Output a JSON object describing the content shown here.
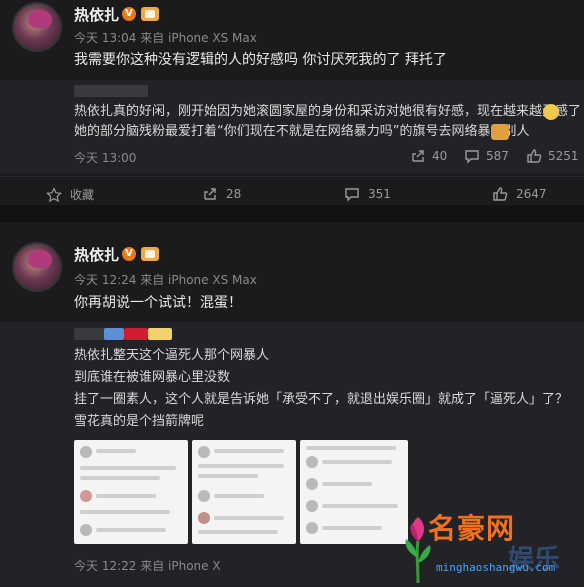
{
  "post1": {
    "username": "热依扎",
    "v_badge": "V",
    "meta": "今天 13:04 来自 iPhone XS Max",
    "text": "我需要你这种没有逻辑的人的好感吗 你讨厌死我的了 拜托了",
    "repost": {
      "line1": "热依扎真的好闲，刚开始因为她滚圆家屋的身份和采访对她很有好感，现在越来越无感了",
      "line2": "她的部分脑残粉最爱打着“你们现在不就是在网络暴力吗”的旗号去网络暴力别人",
      "meta": "今天 13:00",
      "stats": {
        "share": "40",
        "comment": "587",
        "like": "5251"
      }
    },
    "toolbar": {
      "fav": "收藏",
      "share": "28",
      "comment": "351",
      "like": "2647"
    }
  },
  "post2": {
    "username": "热依扎",
    "v_badge": "V",
    "meta": "今天 12:24 来自 iPhone XS Max",
    "text": "你再胡说一个试试！混蛋！",
    "repost": {
      "line1": "热依扎整天这个逼死人那个网暴人",
      "line2": "到底谁在被谁网暴心里没数",
      "line3": "挂了一圈素人，这个人就是告诉她「承受不了，就退出娱乐圈」就成了「逼死人」了？",
      "line4": "雪花真的是个挡箭牌呢",
      "meta": "今天 12:22 来自 iPhone X"
    }
  },
  "watermark": {
    "title": "名豪网",
    "domain": "minghaoshangwu.com",
    "bg_text": "娱乐"
  },
  "colors": {
    "badge": "#e67c12",
    "watermark_orange": "#f27020",
    "watermark_blue": "#4aa3ff"
  }
}
